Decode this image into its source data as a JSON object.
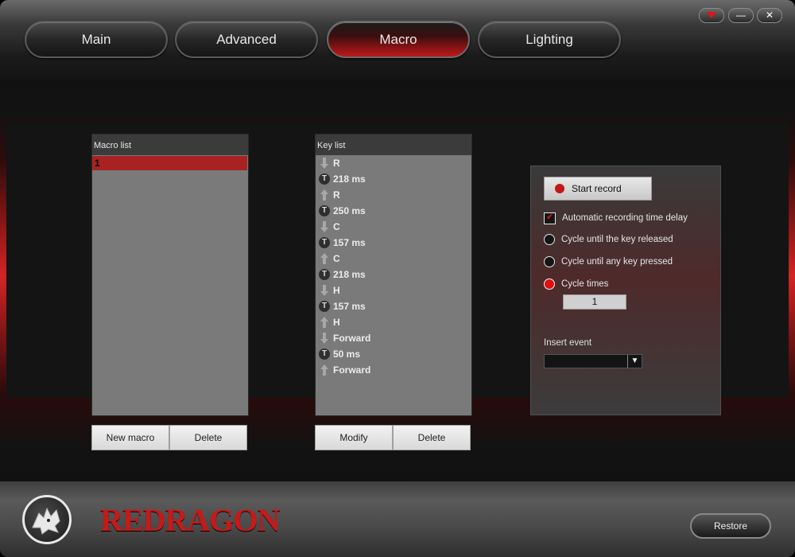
{
  "window": {
    "controls": [
      {
        "name": "menu",
        "icon": "triangle-down-icon"
      },
      {
        "name": "minimize",
        "icon": "minimize-icon",
        "glyph": "—"
      },
      {
        "name": "close",
        "icon": "close-icon",
        "glyph": "✕"
      }
    ]
  },
  "tabs": [
    {
      "label": "Main",
      "active": false
    },
    {
      "label": "Advanced",
      "active": false
    },
    {
      "label": "Macro",
      "active": true
    },
    {
      "label": "Lighting",
      "active": false
    }
  ],
  "macro_list": {
    "title": "Macro list",
    "items": [
      "1"
    ],
    "selected_index": 0,
    "buttons": {
      "new": "New macro",
      "delete": "Delete"
    }
  },
  "key_list": {
    "title": "Key list",
    "rows": [
      {
        "icon": "arrow-down-icon",
        "text": "R"
      },
      {
        "icon": "timer-t-icon",
        "text": "218 ms"
      },
      {
        "icon": "arrow-up-icon",
        "text": "R"
      },
      {
        "icon": "timer-t-icon",
        "text": "250 ms"
      },
      {
        "icon": "arrow-down-icon",
        "text": "C"
      },
      {
        "icon": "timer-t-icon",
        "text": "157 ms"
      },
      {
        "icon": "arrow-up-icon",
        "text": "C"
      },
      {
        "icon": "timer-t-icon",
        "text": "218 ms"
      },
      {
        "icon": "arrow-down-icon",
        "text": "H"
      },
      {
        "icon": "timer-t-icon",
        "text": "157 ms"
      },
      {
        "icon": "arrow-up-icon",
        "text": "H"
      },
      {
        "icon": "arrow-down-icon",
        "text": "Forward"
      },
      {
        "icon": "timer-t-icon",
        "text": "50 ms"
      },
      {
        "icon": "arrow-up-icon",
        "text": "Forward"
      }
    ],
    "buttons": {
      "modify": "Modify",
      "delete": "Delete"
    }
  },
  "record": {
    "start_label": "Start record",
    "auto_delay_label": "Automatic recording time delay",
    "auto_delay_checked": true,
    "options": [
      {
        "label": "Cycle until the key released",
        "selected": false
      },
      {
        "label": "Cycle until any key pressed",
        "selected": false
      },
      {
        "label": "Cycle times",
        "selected": true
      }
    ],
    "cycle_times_value": "1",
    "insert_event_label": "Insert event",
    "insert_event_value": ""
  },
  "footer": {
    "brand": "REDRAGON",
    "restore_label": "Restore"
  },
  "colors": {
    "accent": "#c31818",
    "selected_row": "#a82222",
    "panel_bg": "#7a7a7a"
  }
}
